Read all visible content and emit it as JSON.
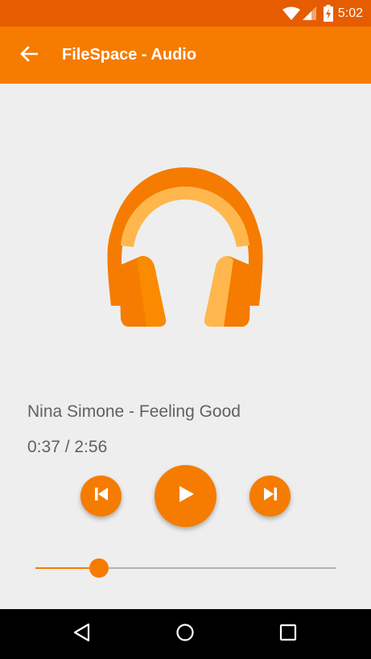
{
  "status_bar": {
    "time": "5:02",
    "icons": [
      "wifi-icon",
      "cell-signal-icon",
      "battery-charging-icon"
    ]
  },
  "app_bar": {
    "title": "FileSpace - Audio",
    "back_icon": "arrow-back-icon"
  },
  "player": {
    "album_art_icon": "headphones-icon",
    "track_title": "Nina Simone - Feeling Good",
    "time_display": "0:37 / 2:56",
    "position": "0:37",
    "duration": "2:56",
    "progress_fraction": 0.21,
    "controls": {
      "previous_icon": "skip-previous-icon",
      "play_icon": "play-icon",
      "next_icon": "skip-next-icon"
    }
  },
  "nav_bar": {
    "icons": [
      "nav-back-icon",
      "nav-home-icon",
      "nav-recents-icon"
    ]
  },
  "colors": {
    "status_bar": "#e65c00",
    "app_bar": "#f57c00",
    "accent": "#f57c00",
    "background": "#eeeeee",
    "text_secondary": "#616161",
    "nav_bar": "#000000"
  }
}
